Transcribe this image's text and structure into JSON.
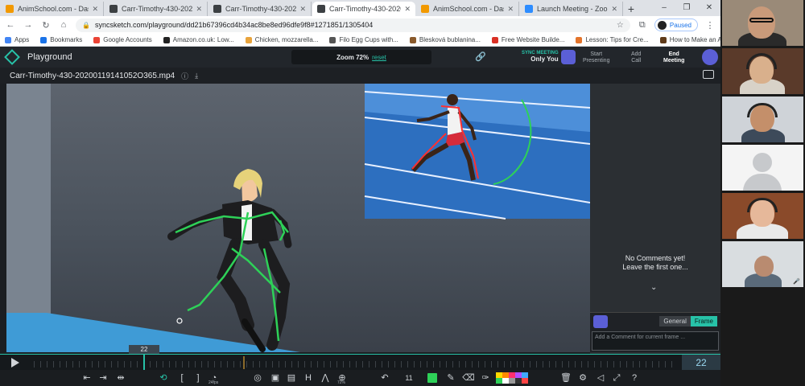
{
  "browser": {
    "tabs": [
      {
        "title": "AnimSchool.com - Dashboa...",
        "favicon_color": "#f29900",
        "active": false
      },
      {
        "title": "Carr-Timothy-430-20200119...",
        "favicon_color": "#3c4043",
        "active": false
      },
      {
        "title": "Carr-Timothy-430-20200119...",
        "favicon_color": "#3c4043",
        "active": false
      },
      {
        "title": "Carr-Timothy-430-20200119...",
        "favicon_color": "#3c4043",
        "active": true
      },
      {
        "title": "AnimSchool.com - Dashboa...",
        "favicon_color": "#f29900",
        "active": false
      },
      {
        "title": "Launch Meeting - Zoom",
        "favicon_color": "#2d8cff",
        "active": false
      }
    ],
    "new_tab": "+",
    "window_controls": {
      "minimize": "–",
      "maximize": "❐",
      "close": "✕"
    },
    "url": "syncsketch.com/playground/dd21b67396cd4b34ac8be8ed96dfe9f8#1271851/1305404",
    "profile_status": "Paused",
    "bookmarks": [
      {
        "label": "Apps",
        "color": "#4285f4"
      },
      {
        "label": "Bookmarks",
        "color": "#1a73e8"
      },
      {
        "label": "Google Accounts",
        "color": "#ea4335"
      },
      {
        "label": "Amazon.co.uk: Low...",
        "color": "#222222"
      },
      {
        "label": "Chicken, mozzarella...",
        "color": "#e8a33c"
      },
      {
        "label": "Filo Egg Cups with...",
        "color": "#555555"
      },
      {
        "label": "Blesková bublanina...",
        "color": "#8a5a2c"
      },
      {
        "label": "Free Website Builde...",
        "color": "#d93025"
      },
      {
        "label": "Lesson: Tips for Cre...",
        "color": "#e3742b"
      },
      {
        "label": "How to Make an A...",
        "color": "#5f3b1a"
      }
    ]
  },
  "syncsketch": {
    "app_title": "Playground",
    "zoom_label": "Zoom 72%",
    "zoom_reset": "reset",
    "sync_meeting_label": "SYNC MEETING",
    "sync_meeting_user": "Only You",
    "start_presenting": [
      "Start",
      "Presenting"
    ],
    "add_call": [
      "Add",
      "Call"
    ],
    "end_meeting": [
      "End",
      "Meeting"
    ],
    "filename": "Carr-Timothy-430-20200119141052O365.mp4",
    "no_comments": [
      "No Comments yet!",
      "Leave the first one..."
    ],
    "comment_tabs": [
      "General",
      "Frame"
    ],
    "comment_placeholder": "Add a Comment for current frame ...",
    "playhead_frame": "22",
    "frame_counter": "22",
    "fps_label": "24fps",
    "zoom_tool_label": "72%",
    "step_count": "11",
    "accent_color": "#27c2a8",
    "palette": [
      "#ffd900",
      "#ff8a00",
      "#ff2f6e",
      "#b44dff",
      "#3fa9ff",
      "#2ed158",
      "#ffffff",
      "#999999",
      "#333333",
      "#ff4444"
    ]
  },
  "zoom_participants": [
    "participant-1",
    "participant-2",
    "participant-3",
    "participant-4",
    "participant-5",
    "participant-6"
  ]
}
